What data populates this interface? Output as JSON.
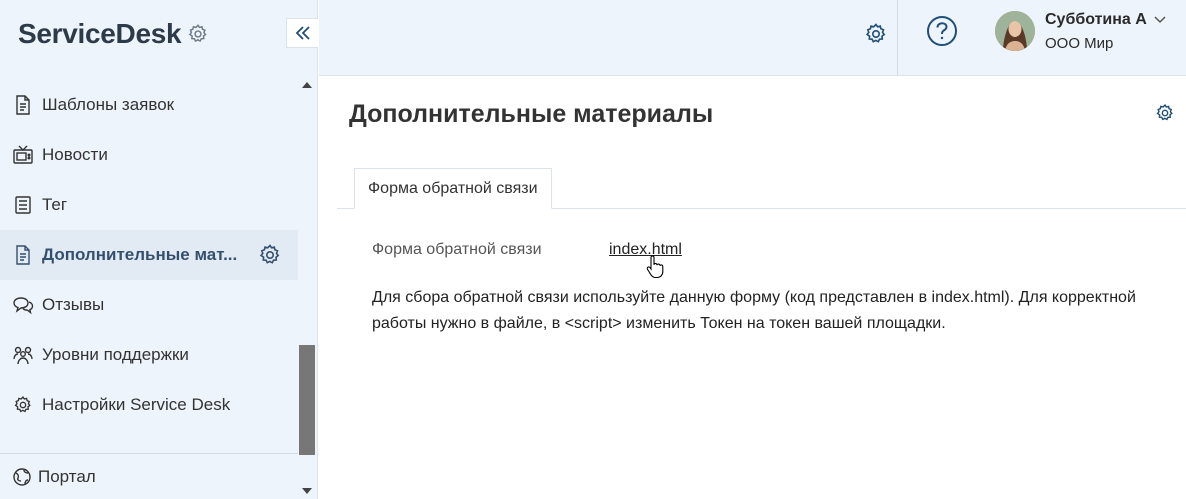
{
  "app": {
    "title": "ServiceDesk"
  },
  "sidebar": {
    "items": [
      {
        "label": "Шаблоны заявок",
        "icon": "document-icon"
      },
      {
        "label": "Новости",
        "icon": "tv-icon"
      },
      {
        "label": "Тег",
        "icon": "tag-list-icon"
      },
      {
        "label": "Дополнительные мат...",
        "icon": "document-icon",
        "active": true
      },
      {
        "label": "Отзывы",
        "icon": "chat-bubbles-icon"
      },
      {
        "label": "Уровни поддержки",
        "icon": "people-icon"
      },
      {
        "label": "Настройки Service Desk",
        "icon": "gear-icon"
      }
    ],
    "footer_label": "Портал"
  },
  "header": {
    "user_name": "Субботина А",
    "user_org": "ООО Мир"
  },
  "main": {
    "title": "Дополнительные материалы",
    "tabs": [
      {
        "label": "Форма обратной связи",
        "active": true
      }
    ],
    "field_label": "Форма обратной связи",
    "field_link": "index.html",
    "description": "Для сбора обратной связи используйте данную форму (код представлен в index.html). Для корректной работы нужно в файле, в <script> изменить Токен на токен вашей площадки."
  },
  "colors": {
    "sidebar_bg": "#eef4fb",
    "active_item_bg": "#e2eaf3",
    "active_text": "#35506e",
    "accent_icon": "#1f4e79"
  }
}
